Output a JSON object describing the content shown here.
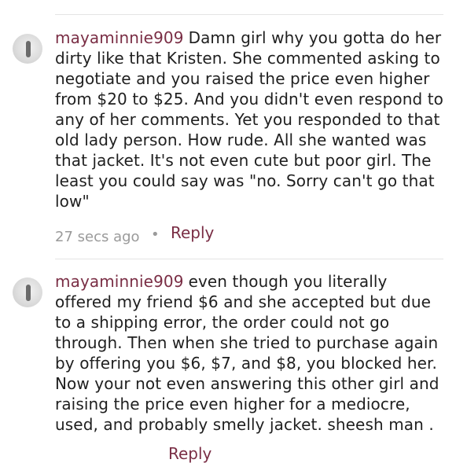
{
  "comments": [
    {
      "username": "mayaminnie909",
      "text": "Damn girl why you gotta do her dirty like that Kristen. She commented asking to negotiate and you raised the price even higher from $20 to $25. And you didn't even respond to any of her comments. Yet you responded to that old lady person. How rude. All she wanted was that jacket. It's not even cute but poor girl. The least you could say was \"no. Sorry can't go that low\"",
      "timestamp": "27 secs ago",
      "separator": "•",
      "reply_label": "Reply"
    },
    {
      "username": "mayaminnie909",
      "text": "even though you literally offered my friend $6 and she accepted but due to a shipping error, the order could not go through. Then when she tried to purchase again by offering you $6, $7, and $8, you blocked her. Now your not even answering this other girl and raising the price even higher for a mediocre, used, and probably smelly jacket. sheesh man .",
      "timestamp": "",
      "separator": "",
      "reply_label": "Reply"
    }
  ],
  "icons": {
    "avatar": "user-avatar-icon"
  },
  "colors": {
    "username": "#7a2e45",
    "reply": "#7a2e45",
    "meta": "#9a9a9a",
    "text": "#1f1f1f",
    "divider": "#e4e4e4"
  }
}
